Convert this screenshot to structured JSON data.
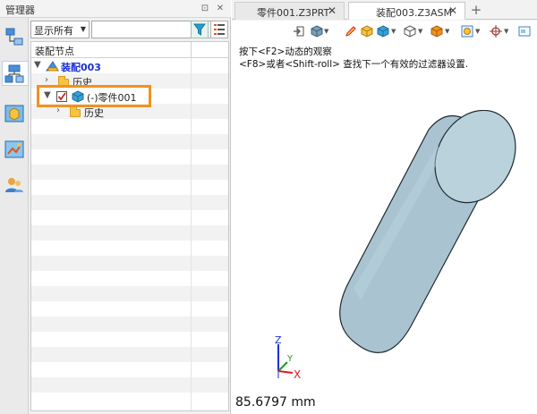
{
  "manager": {
    "title": "管理器",
    "pin_glyph": "⊡",
    "close_glyph": "✕"
  },
  "filter": {
    "display_value": "显示所有",
    "search_placeholder": ""
  },
  "tree": {
    "column_header": "装配节点",
    "nodes": [
      {
        "label": "装配003"
      },
      {
        "label": "历史"
      },
      {
        "label": "(-)零件001"
      },
      {
        "label": "历史"
      }
    ]
  },
  "tabs": [
    {
      "label": "零件001.Z3PRT",
      "close": "✕"
    },
    {
      "label": "装配003.Z3ASM",
      "close": "✕"
    }
  ],
  "tab_add": "+",
  "hint": {
    "line1": "按下<F2>动态的观察",
    "line2": "<F8>或者<Shift-roll> 查找下一个有效的过滤器设置."
  },
  "measurement": "85.6797 mm",
  "triad": {
    "x": "X",
    "y": "Y",
    "z": "Z"
  },
  "colors": {
    "highlight_box": "#f0931e",
    "cylinder_fill": "#a9c4d0",
    "assembly_label": "#1a2fd6",
    "checkbox_red": "#d62020"
  }
}
